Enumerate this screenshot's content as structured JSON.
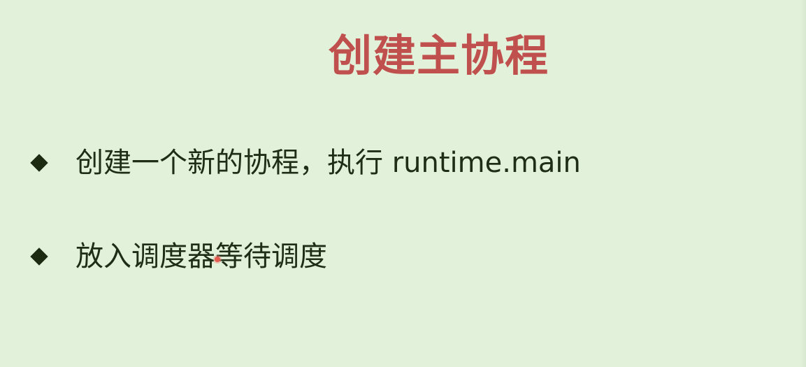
{
  "slide": {
    "title": "创建主协程",
    "title_color": "#c0504d",
    "background_color": "#e2f2da",
    "bullets": [
      {
        "icon": "diamond-bullet-icon",
        "text": "创建一个新的协程，执行 runtime.main"
      },
      {
        "icon": "diamond-bullet-icon",
        "text": "放入调度器等待调度"
      }
    ]
  },
  "cursor": {
    "icon": "pointer-dot-icon",
    "color": "#e35c4e"
  }
}
